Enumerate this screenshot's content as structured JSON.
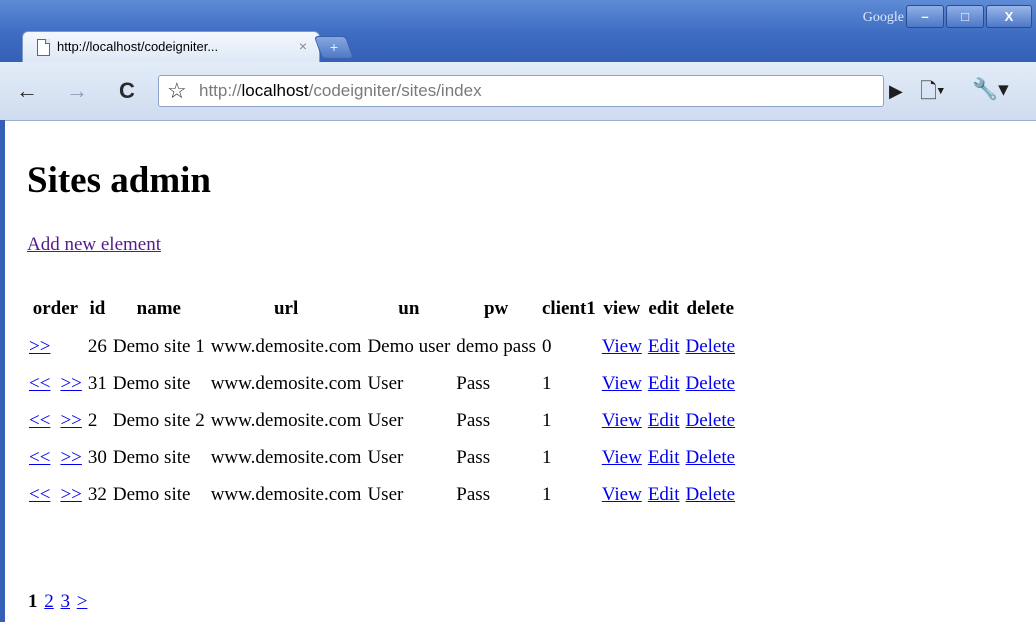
{
  "window": {
    "brand": "Google",
    "minimize": "–",
    "maximize": "□",
    "close": "X"
  },
  "tab": {
    "title": "http://localhost/codeigniter...",
    "close": "×",
    "new_tab": "+"
  },
  "toolbar": {
    "back": "←",
    "forward": "→",
    "reload": "C",
    "star": "☆",
    "url_prefix": "http://",
    "url_host": "localhost",
    "url_path": "/codeigniter/sites/index",
    "go": "▶",
    "page_menu": "🗋▾",
    "wrench_menu": "🔧▾"
  },
  "page": {
    "title": "Sites admin",
    "add_link": "Add new element",
    "columns": [
      "order",
      "id",
      "name",
      "url",
      "un",
      "pw",
      "client1",
      "view",
      "edit",
      "delete"
    ],
    "rows": [
      {
        "up": "",
        "down": ">>",
        "id": "26",
        "name": "Demo site 1",
        "url": "www.demosite.com",
        "un": "Demo user",
        "pw": "demo pass",
        "client1": "0",
        "view": "View",
        "edit": "Edit",
        "delete": "Delete"
      },
      {
        "up": "<<",
        "down": ">>",
        "id": "31",
        "name": "Demo site",
        "url": "www.demosite.com",
        "un": "User",
        "pw": "Pass",
        "client1": "1",
        "view": "View",
        "edit": "Edit",
        "delete": "Delete"
      },
      {
        "up": "<<",
        "down": ">>",
        "id": "2",
        "name": "Demo site 2",
        "url": "www.demosite.com",
        "un": "User",
        "pw": "Pass",
        "client1": "1",
        "view": "View",
        "edit": "Edit",
        "delete": "Delete"
      },
      {
        "up": "<<",
        "down": ">>",
        "id": "30",
        "name": "Demo site",
        "url": "www.demosite.com",
        "un": "User",
        "pw": "Pass",
        "client1": "1",
        "view": "View",
        "edit": "Edit",
        "delete": "Delete"
      },
      {
        "up": "<<",
        "down": ">>",
        "id": "32",
        "name": "Demo site",
        "url": "www.demosite.com",
        "un": "User",
        "pw": "Pass",
        "client1": "1",
        "view": "View",
        "edit": "Edit",
        "delete": "Delete"
      }
    ],
    "pagination": {
      "current": "1",
      "pages": [
        "2",
        "3"
      ],
      "next": ">"
    }
  },
  "colors": {
    "frame": "#3461b6",
    "link": "#0000ee",
    "visited_link": "#551a8b"
  }
}
